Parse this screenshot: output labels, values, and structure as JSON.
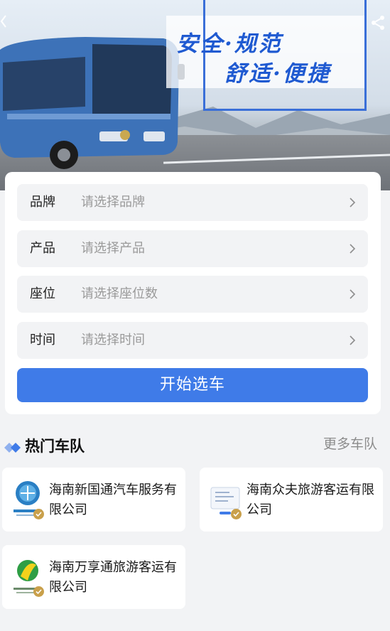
{
  "banner": {
    "slogan_line1": "安全·规范",
    "slogan_line2": "舒适·便捷",
    "accent_color": "#3a6fd8"
  },
  "form": {
    "fields": [
      {
        "label": "品牌",
        "placeholder": "请选择品牌"
      },
      {
        "label": "产品",
        "placeholder": "请选择产品"
      },
      {
        "label": "座位",
        "placeholder": "请选择座位数"
      },
      {
        "label": "时间",
        "placeholder": "请选择时间"
      }
    ],
    "submit_label": "开始选车",
    "submit_color": "#3f7be8"
  },
  "hot_fleets": {
    "title": "热门车队",
    "more_label": "更多车队",
    "items": [
      {
        "name": "海南新国通汽车服务有限公司",
        "logo_icon": "blue-circle-logo-icon",
        "verified": true
      },
      {
        "name": "海南众夫旅游客运有限公司",
        "logo_icon": "document-logo-icon",
        "verified": true
      },
      {
        "name": "海南万享通旅游客运有限公司",
        "logo_icon": "green-yellow-logo-icon",
        "verified": true
      }
    ]
  }
}
